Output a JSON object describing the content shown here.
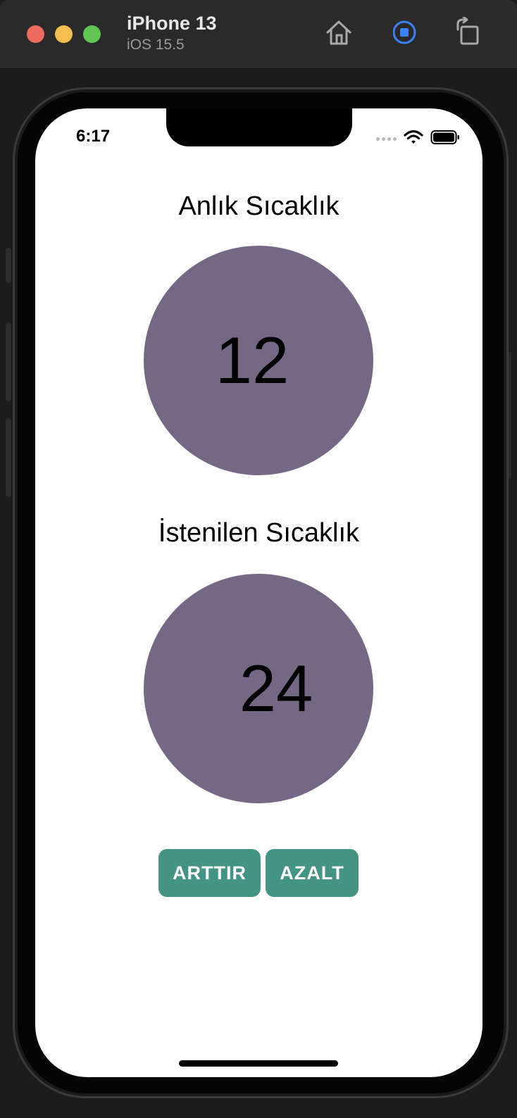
{
  "simulator": {
    "device_name": "iPhone 13",
    "os_version": "iOS 15.5",
    "icons": [
      "home-icon",
      "stop-recording-icon",
      "rotate-icon"
    ]
  },
  "status_bar": {
    "time": "6:17",
    "icons": [
      "signal-icon",
      "wifi-icon",
      "battery-icon"
    ]
  },
  "app": {
    "current_temp": {
      "label": "Anlık Sıcaklık",
      "value": "12"
    },
    "target_temp": {
      "label": "İstenilen Sıcaklık",
      "value": "24"
    },
    "buttons": {
      "increase": "ARTTIR",
      "decrease": "AZALT"
    }
  },
  "colors": {
    "circle": "#756885",
    "button": "#449486",
    "stop_icon": "#3b82f6"
  }
}
